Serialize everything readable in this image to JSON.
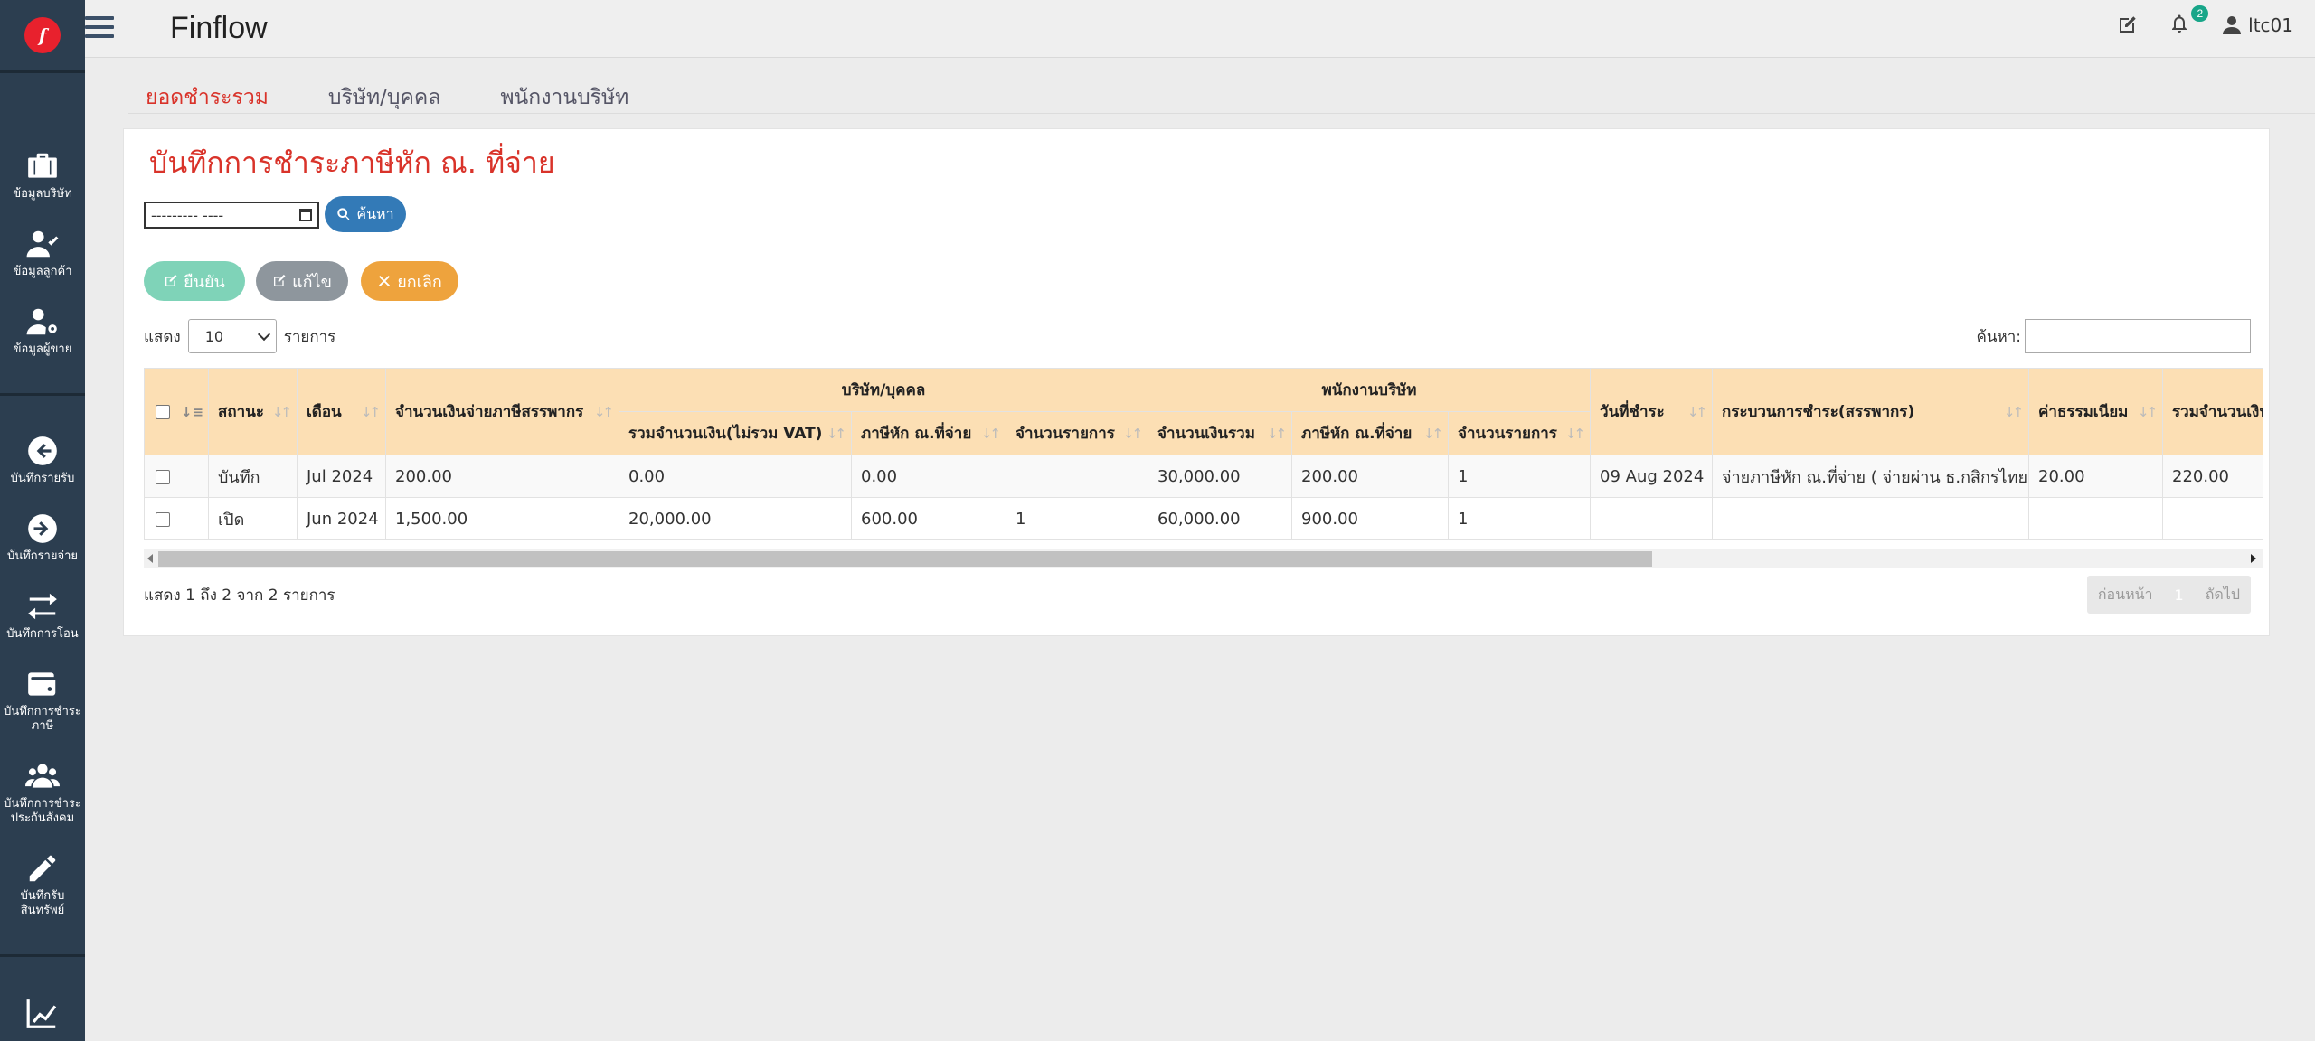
{
  "app": {
    "brand": "Finflow",
    "logo_letter": "f"
  },
  "sidebar": {
    "items": [
      {
        "label": "ข้อมูลบริษัท",
        "icon": "briefcase-icon"
      },
      {
        "label": "ข้อมูลลูกค้า",
        "icon": "user-check-icon"
      },
      {
        "label": "ข้อมูลผู้ขาย",
        "icon": "user-gear-icon"
      },
      {
        "label": "บันทึกรายรับ",
        "icon": "arrow-left-circle-icon"
      },
      {
        "label": "บันทึกรายจ่าย",
        "icon": "arrow-right-circle-icon"
      },
      {
        "label": "บันทึกการโอน",
        "icon": "exchange-icon"
      },
      {
        "label": "บันทึกการชำระ\nภาษี",
        "icon": "wallet-icon"
      },
      {
        "label": "บันทึกการชำระ\nประกันสังคม",
        "icon": "users-icon"
      },
      {
        "label": "บันทึกรับ\nสินทรัพย์",
        "icon": "pencil-icon"
      },
      {
        "label": "",
        "icon": "chart-icon"
      }
    ]
  },
  "topbar": {
    "notification_count": "2",
    "username": "ltc01"
  },
  "tabs": [
    {
      "label": "ยอดชำระรวม",
      "active": true
    },
    {
      "label": "บริษัท/บุคคล",
      "active": false
    },
    {
      "label": "พนักงานบริษัท",
      "active": false
    }
  ],
  "page": {
    "title": "บันทึกการชำระภาษีหัก ณ. ที่จ่าย",
    "date_placeholder": "--------- ----",
    "search_button": "ค้นหา",
    "confirm_button": "ยืนยัน",
    "edit_button": "แก้ไข",
    "cancel_button": "ยกเลิก",
    "length_prefix": "แสดง",
    "length_value": "10",
    "length_suffix": "รายการ",
    "search_label": "ค้นหา:",
    "info_text": "แสดง 1 ถึง 2 จาก 2 รายการ",
    "pager": {
      "prev": "ก่อนหน้า",
      "current": "1",
      "next": "ถัดไป"
    }
  },
  "table": {
    "group_company": "บริษัท/บุคคล",
    "group_employee": "พนักงานบริษัท",
    "headers": {
      "status": "สถานะ",
      "month": "เดือน",
      "total_tax": "จำนวนเงินจ่ายภาษีสรรพากร",
      "co_total": "รวมจำนวนเงิน(ไม่รวม VAT)",
      "co_tax": "ภาษีหัก ณ.ที่จ่าย",
      "co_count": "จำนวนรายการ",
      "emp_total": "จำนวนเงินรวม",
      "emp_tax": "ภาษีหัก ณ.ที่จ่าย",
      "emp_count": "จำนวนรายการ",
      "pay_date": "วันที่ชำระ",
      "process": "กระบวนการชำระ(สรรพากร)",
      "fee": "ค่าธรรมเนียม",
      "grand_total": "รวมจำนวนเงิน"
    },
    "rows": [
      {
        "status": "บันทึก",
        "month": "Jul 2024",
        "total_tax": "200.00",
        "co_total": "0.00",
        "co_tax": "0.00",
        "co_count": "",
        "emp_total": "30,000.00",
        "emp_tax": "200.00",
        "emp_count": "1",
        "pay_date": "09 Aug 2024",
        "process": "จ่ายภาษีหัก ณ.ที่จ่าย ( จ่ายผ่าน ธ.กสิกรไทย )",
        "fee": "20.00",
        "grand_total": "220.00"
      },
      {
        "status": "เปิด",
        "month": "Jun 2024",
        "total_tax": "1,500.00",
        "co_total": "20,000.00",
        "co_tax": "600.00",
        "co_count": "1",
        "emp_total": "60,000.00",
        "emp_tax": "900.00",
        "emp_count": "1",
        "pay_date": "",
        "process": "",
        "fee": "",
        "grand_total": ""
      }
    ]
  },
  "colors": {
    "sidebar": "#2c3e50",
    "accent_red": "#d9332a",
    "header_bg": "#fcdfb4",
    "search_btn": "#337ab7",
    "confirm_btn": "#7fd3b8",
    "edit_btn": "#8e969d",
    "cancel_btn": "#eea33d"
  }
}
